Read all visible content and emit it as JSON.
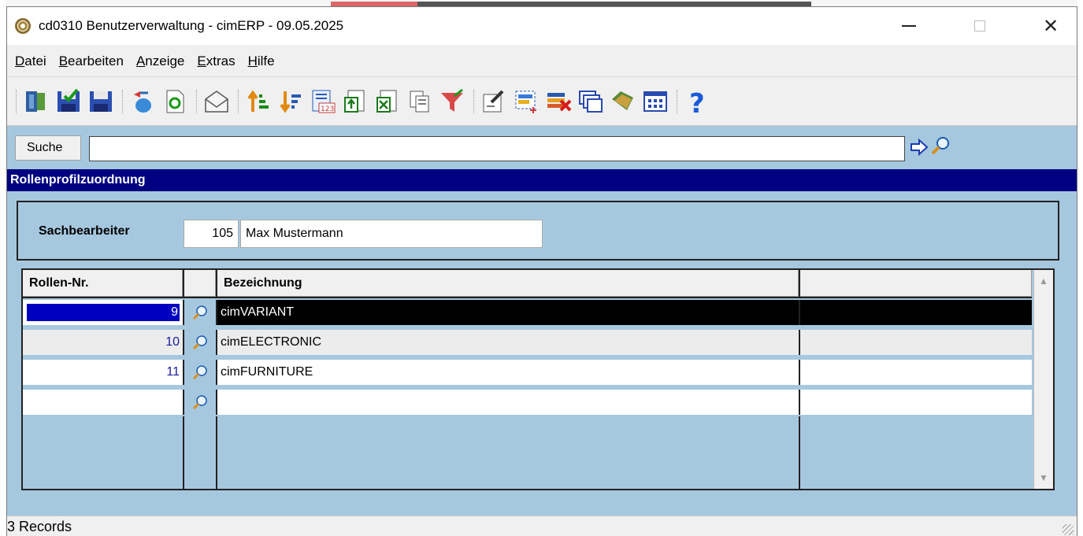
{
  "window": {
    "title": "cd0310 Benutzerverwaltung - cimERP - 09.05.2025",
    "controls": {
      "minimize": "—",
      "maximize": "☐",
      "close": "✕"
    }
  },
  "menu": {
    "items": [
      {
        "label": "Datei"
      },
      {
        "label": "Bearbeiten"
      },
      {
        "label": "Anzeige"
      },
      {
        "label": "Extras"
      },
      {
        "label": "Hilfe"
      }
    ]
  },
  "toolbar": {
    "buttons": [
      "exit-icon",
      "save-close-icon",
      "save-icon",
      "refresh-db-icon",
      "reload-icon",
      "mail-icon",
      "sort-asc-icon",
      "sort-desc-icon",
      "number-format-icon",
      "import-icon",
      "export-icon",
      "excel-export-icon",
      "copy-icon",
      "filter-icon",
      "properties-icon",
      "select-area-icon",
      "delete-row-icon",
      "windows-icon",
      "tag-icon",
      "grid-view-icon",
      "help-icon"
    ]
  },
  "search": {
    "label": "Suche",
    "value": ""
  },
  "section": {
    "title": "Rollenprofilzuordnung"
  },
  "sachbearbeiter": {
    "label": "Sachbearbeiter",
    "number": "105",
    "name": "Max Mustermann"
  },
  "grid": {
    "columns": [
      "Rollen-Nr.",
      "",
      "Bezeichnung",
      ""
    ],
    "rows": [
      {
        "nr": "9",
        "bezeichnung": "cimVARIANT"
      },
      {
        "nr": "10",
        "bezeichnung": "cimELECTRONIC"
      },
      {
        "nr": "11",
        "bezeichnung": "cimFURNITURE"
      },
      {
        "nr": "",
        "bezeichnung": ""
      }
    ]
  },
  "status": {
    "text": "3 Records"
  },
  "colors": {
    "section_header": "#000080",
    "panel_bg": "#a6c8df",
    "selection": "#0000c0"
  }
}
